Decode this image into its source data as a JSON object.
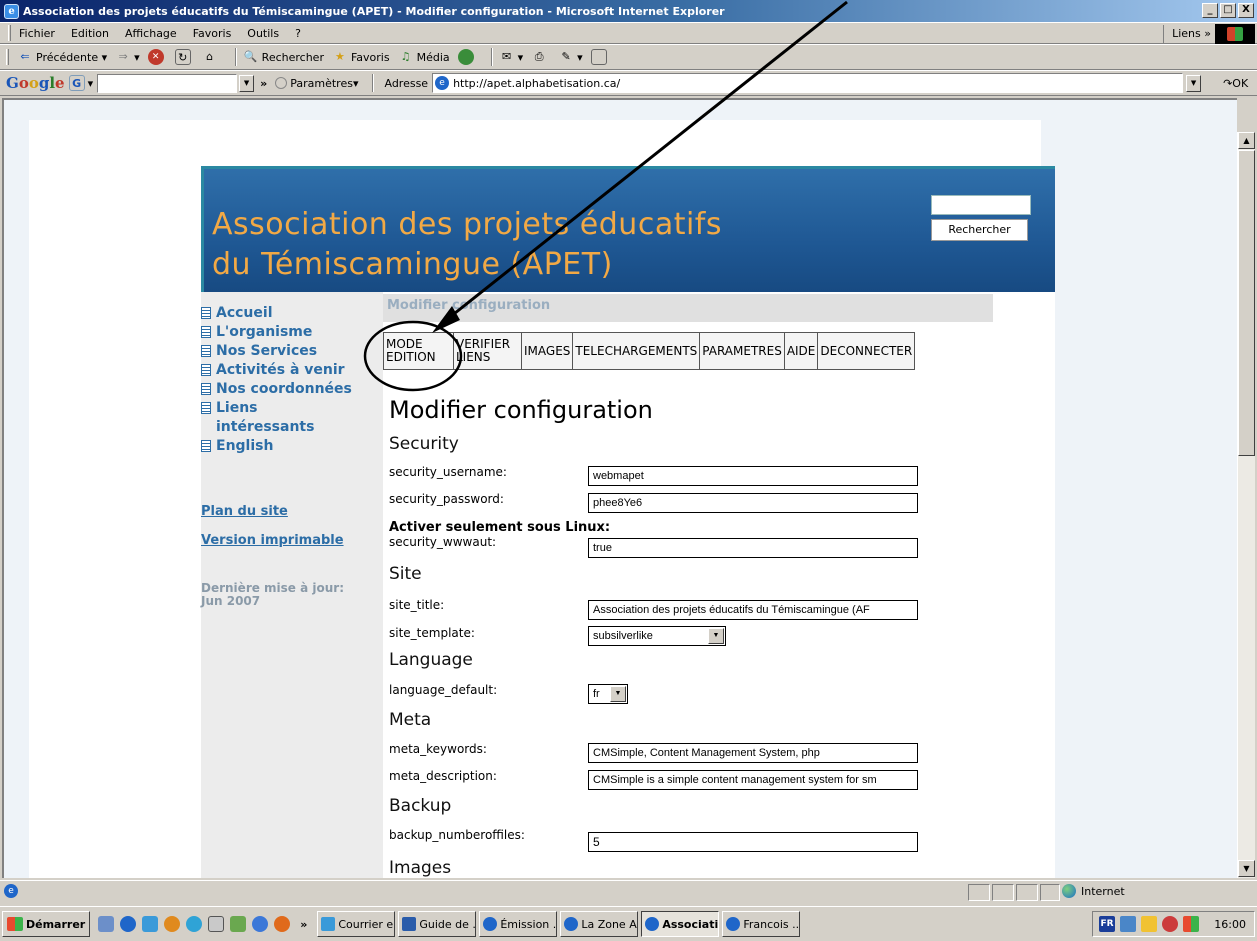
{
  "window": {
    "title": "Association des projets éducatifs du Témiscamingue (APET) - Modifier configuration - Microsoft Internet Explorer",
    "controls": [
      "_",
      "□",
      "X"
    ]
  },
  "menubar": {
    "items": [
      "Fichier",
      "Edition",
      "Affichage",
      "Favoris",
      "Outils",
      "?"
    ],
    "links_label": "Liens »"
  },
  "toolbar": {
    "back": "Précédente",
    "search": "Rechercher",
    "favorites": "Favoris",
    "media": "Média"
  },
  "googlebar": {
    "logo": "Google",
    "chevron": "»",
    "settings": "Paramètres▾",
    "address_label": "Adresse",
    "address_value": "http://apet.alphabetisation.ca/",
    "go_label": "OK"
  },
  "site": {
    "title_line1": "Association des projets éducatifs",
    "title_line2": "du Témiscamingue (APET)",
    "search_button": "Rechercher",
    "nav": [
      "Accueil",
      "L'organisme",
      "Nos Services",
      "Activités à venir",
      "Nos coordonnées",
      "Liens intéressants",
      "English"
    ],
    "sitemap": "Plan du site",
    "printable": "Version imprimable",
    "last_update": "Dernière mise à jour:",
    "last_update_date": "Jun 2007"
  },
  "admin": {
    "breadcrumb": "Modifier configuration",
    "menu": [
      "MODE EDITION",
      "VERIFIER LIENS",
      "IMAGES",
      "TELECHARGEMENTS",
      "PARAMETRES",
      "AIDE",
      "DECONNECTER"
    ],
    "heading": "Modifier configuration",
    "sections": {
      "security": "Security",
      "site": "Site",
      "language": "Language",
      "meta": "Meta",
      "backup": "Backup",
      "images": "Images"
    },
    "linux_hint": "Activer seulement sous Linux:",
    "fields": {
      "security_username": {
        "label": "security_username:",
        "value": "webmapet"
      },
      "security_password": {
        "label": "security_password:",
        "value": "phee8Ye6"
      },
      "security_wwwaut": {
        "label": "security_wwwaut:",
        "value": "true"
      },
      "site_title": {
        "label": "site_title:",
        "value": "Association des projets éducatifs du Témiscamingue (AF"
      },
      "site_template": {
        "label": "site_template:",
        "value": "subsilverlike"
      },
      "language_default": {
        "label": "language_default:",
        "value": "fr"
      },
      "meta_keywords": {
        "label": "meta_keywords:",
        "value": "CMSimple, Content Management System, php"
      },
      "meta_description": {
        "label": "meta_description:",
        "value": "CMSimple is a simple content management system for sm"
      },
      "backup_numberoffiles": {
        "label": "backup_numberoffiles:",
        "value": "5"
      }
    }
  },
  "statusbar": {
    "zone": "Internet"
  },
  "taskbar": {
    "start": "Démarrer",
    "overflow": "»",
    "tasks": [
      "Courrier e...",
      "Guide de ...",
      "Émission ...",
      "La Zone A...",
      "Associati...",
      "Francois ..."
    ],
    "active_index": 4,
    "lang": "FR",
    "clock": "16:00"
  },
  "colors": {
    "banner": "#1f5894",
    "title_orange": "#f2a945",
    "nav_blue": "#2c6da6"
  }
}
